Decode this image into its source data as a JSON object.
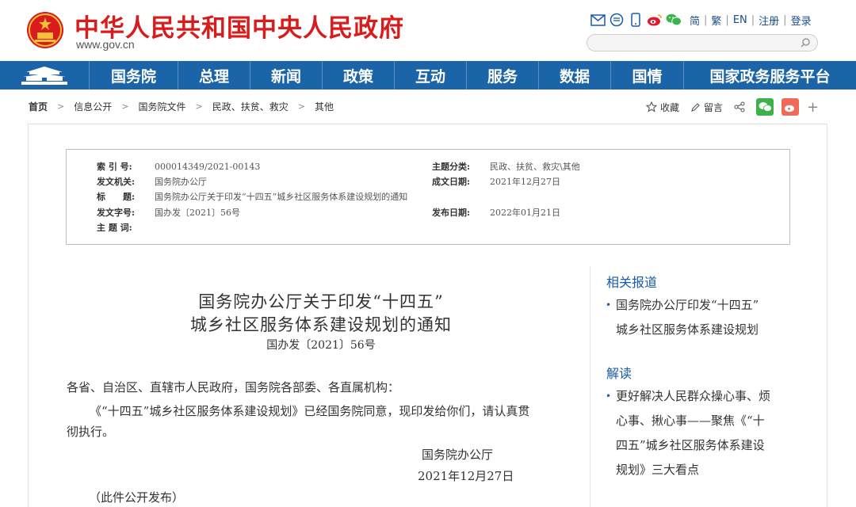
{
  "header": {
    "title": "中华人民共和国中央人民政府",
    "url": "www.gov.cn",
    "links": [
      "简",
      "繁",
      "EN",
      "注册",
      "登录"
    ],
    "icons": [
      "mail-icon",
      "chat-bubble-icon",
      "mobile-icon",
      "weibo-icon",
      "wechat-icon"
    ]
  },
  "search": {
    "placeholder": ""
  },
  "nav": {
    "items": [
      "国务院",
      "总理",
      "新闻",
      "政策",
      "互动",
      "服务",
      "数据",
      "国情",
      "国家政务服务平台"
    ]
  },
  "breadcrumb": [
    "首页",
    "信息公开",
    "国务院文件",
    "民政、扶贫、救灾",
    "其他"
  ],
  "share": {
    "favorite": "收藏",
    "comment": "留言"
  },
  "meta": {
    "index_label": "索 引 号:",
    "index_value": "000014349/2021-00143",
    "category_label": "主题分类:",
    "category_value": "民政、扶贫、救灾\\其他",
    "issuer_label": "发文机关:",
    "issuer_value": "国务院办公厅",
    "date_made_label": "成文日期:",
    "date_made_value": "2021年12月27日",
    "title_label": "标　　题:",
    "title_value": "国务院办公厅关于印发“十四五”城乡社区服务体系建设规划的通知",
    "doc_no_label": "发文字号:",
    "doc_no_value": "国办发〔2021〕56号",
    "publish_label": "发布日期:",
    "publish_value": "2022年01月21日",
    "keywords_label": "主 题 词:",
    "keywords_value": ""
  },
  "article": {
    "title_line1": "国务院办公厅关于印发“十四五”",
    "title_line2": "城乡社区服务体系建设规划的通知",
    "doc_number": "国办发〔2021〕56号",
    "salutation": "各省、自治区、直辖市人民政府，国务院各部委、各直属机构：",
    "para1_line1": "《“十四五”城乡社区服务体系建设规划》已经国务院同意，现印发给你们，请认真贯",
    "para1_line2": "彻执行。",
    "signature": "国务院办公厅",
    "sign_date": "2021年12月27日",
    "note": "（此件公开发布）"
  },
  "sidebar": {
    "related_title": "相关报道",
    "related_items": [
      [
        "国务院办公厅印发“十四五”",
        "城乡社区服务体系建设规划"
      ]
    ],
    "interpret_title": "解读",
    "interpret_items": [
      [
        "更好解决人民群众操心事、烦",
        "心事、揪心事——聚焦《“十",
        "四五”城乡社区服务体系建设",
        "规划》三大看点"
      ]
    ]
  },
  "colors": {
    "brand_red": "#d91b1b",
    "nav_blue": "#1c64a8",
    "link_blue": "#1b5aa8",
    "wechat_green": "#3bb34a",
    "weibo_red": "#f06a5a"
  }
}
